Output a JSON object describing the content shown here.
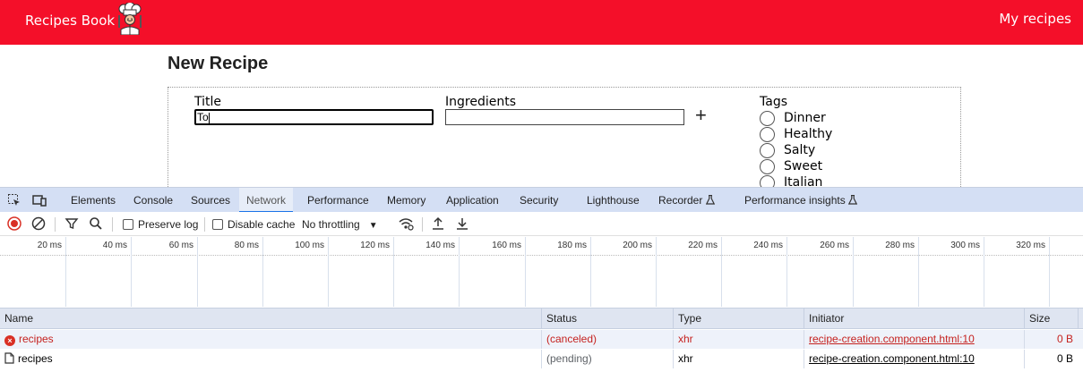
{
  "app": {
    "brand": "Recipes Book",
    "nav_my_recipes": "My recipes",
    "page_title": "New Recipe",
    "form": {
      "title_label": "Title",
      "title_value": "To",
      "ingredients_label": "Ingredients",
      "ingredients_value": "",
      "add_ingredient_symbol": "+",
      "tags_label": "Tags",
      "tags": [
        "Dinner",
        "Healthy",
        "Salty",
        "Sweet",
        "Italian"
      ]
    },
    "colors": {
      "header_bg": "#f40f29",
      "header_text": "#ffffff"
    }
  },
  "devtools": {
    "tabs": [
      "Elements",
      "Console",
      "Sources",
      "Network",
      "Performance",
      "Memory",
      "Application",
      "Security",
      "Lighthouse",
      "Recorder",
      "Performance insights"
    ],
    "active_tab": "Network",
    "toolbar": {
      "preserve_log": "Preserve log",
      "disable_cache": "Disable cache",
      "throttling": "No throttling"
    },
    "timeline_ticks": [
      "20 ms",
      "40 ms",
      "60 ms",
      "80 ms",
      "100 ms",
      "120 ms",
      "140 ms",
      "160 ms",
      "180 ms",
      "200 ms",
      "220 ms",
      "240 ms",
      "260 ms",
      "280 ms",
      "300 ms",
      "320 ms"
    ],
    "columns": {
      "name": "Name",
      "status": "Status",
      "type": "Type",
      "initiator": "Initiator",
      "size": "Size"
    },
    "requests": [
      {
        "name": "recipes",
        "status": "(canceled)",
        "type": "xhr",
        "initiator": "recipe-creation.component.html:10",
        "size": "0 B",
        "error": true
      },
      {
        "name": "recipes",
        "status": "(pending)",
        "type": "xhr",
        "initiator": "recipe-creation.component.html:10",
        "size": "0 B",
        "error": false
      }
    ]
  }
}
